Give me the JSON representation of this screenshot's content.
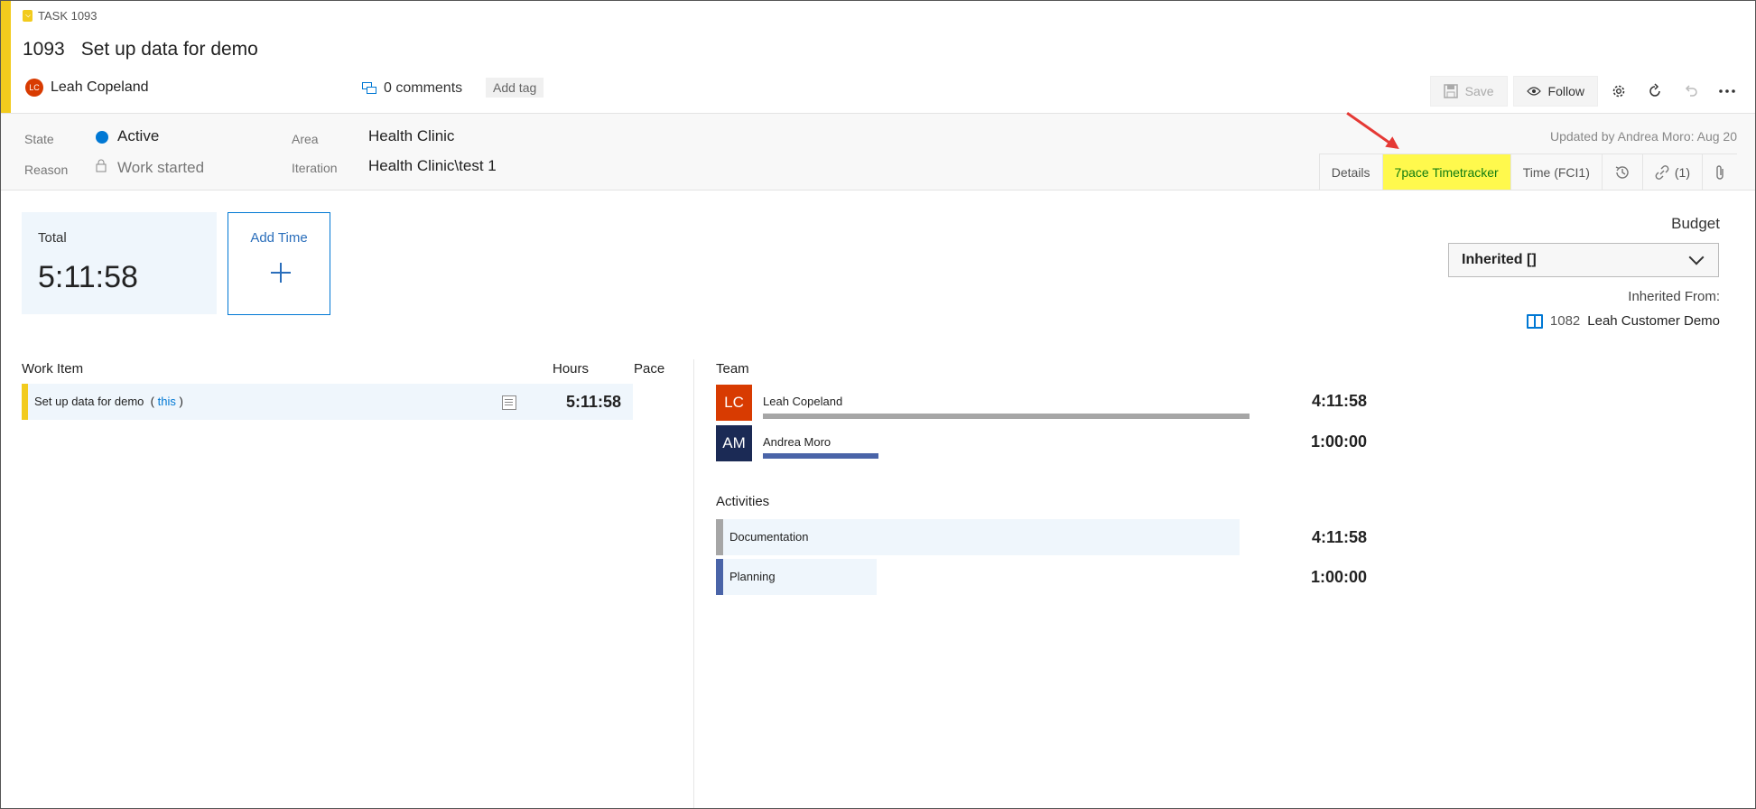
{
  "workitem": {
    "type_label": "TASK 1093",
    "id": "1093",
    "title": "Set up data for demo",
    "assignee": "Leah Copeland",
    "assignee_initials": "LC",
    "comments_label": "0 comments",
    "add_tag_label": "Add tag"
  },
  "toolbar": {
    "save_label": "Save",
    "follow_label": "Follow"
  },
  "fields": {
    "state_label": "State",
    "state_value": "Active",
    "state_color": "#0078d4",
    "reason_label": "Reason",
    "reason_value": "Work started",
    "area_label": "Area",
    "area_value": "Health Clinic",
    "iteration_label": "Iteration",
    "iteration_value": "Health Clinic\\test 1",
    "updated_text": "Updated by Andrea Moro: Aug 20"
  },
  "tabs": [
    {
      "label": "Details"
    },
    {
      "label": "7pace Timetracker",
      "active": true
    },
    {
      "label": "Time (FCI1)"
    },
    {
      "label": "history-icon"
    },
    {
      "label": "(1)"
    },
    {
      "label": "attachment-icon"
    }
  ],
  "summary": {
    "total_label": "Total",
    "total_value": "5:11:58",
    "add_time_label": "Add Time"
  },
  "budget": {
    "label": "Budget",
    "selected": "Inherited []",
    "inherited_from_label": "Inherited From:",
    "inherited_id": "1082",
    "inherited_name": "Leah Customer Demo"
  },
  "worklist": {
    "col_work_item": "Work Item",
    "col_hours": "Hours",
    "col_pace": "Pace",
    "row_name": "Set up data for demo",
    "row_link_open": "(",
    "row_link": "this",
    "row_link_close": ")",
    "row_hours": "5:11:58"
  },
  "team": {
    "heading": "Team",
    "members": [
      {
        "initials": "LC",
        "name": "Leah Copeland",
        "time": "4:11:58",
        "share": 1.0,
        "avatar_color": "#d83b01",
        "bar_color": "#a6a6a6"
      },
      {
        "initials": "AM",
        "name": "Andrea Moro",
        "time": "1:00:00",
        "share": 0.238,
        "avatar_color": "#1b2a55",
        "bar_color": "#4a64a8"
      }
    ]
  },
  "activities": {
    "heading": "Activities",
    "items": [
      {
        "name": "Documentation",
        "time": "4:11:58",
        "share": 1.0,
        "color": "#a6a6a6"
      },
      {
        "name": "Planning",
        "time": "1:00:00",
        "share": 0.238,
        "color": "#4a64a8"
      }
    ]
  }
}
